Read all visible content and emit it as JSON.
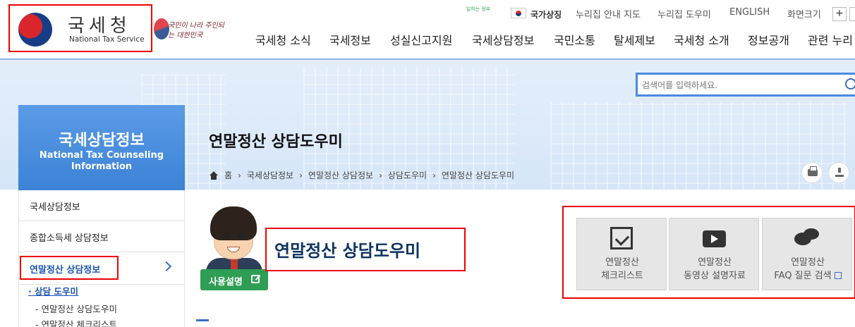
{
  "brand": {
    "name_ko": "국세청",
    "name_en": "National Tax Service",
    "slogan": "국민이 나라 주인되는 대한민국"
  },
  "util_nav": {
    "gov_badge": "일하는 정부",
    "items": [
      "국가상징",
      "누리집 안내 지도",
      "누리집 도우미",
      "ENGLISH",
      "화면크기"
    ],
    "zoom_in": "+"
  },
  "gnb": [
    "국세청 소식",
    "국세정보",
    "성실신고지원",
    "국세상담정보",
    "국민소통",
    "탈세제보",
    "국세청 소개",
    "정보공개",
    "관련 누리"
  ],
  "search": {
    "placeholder": "검색어를 입력하세요."
  },
  "section": {
    "title_ko": "국세상담정보",
    "title_en": "National Tax Counseling Information"
  },
  "page": {
    "title": "연말정산 상담도우미",
    "breadcrumb": [
      "홈",
      "국세상담정보",
      "연말정산 상담정보",
      "상담도우미",
      "연말정산 상담도우미"
    ]
  },
  "sidebar": {
    "items": [
      "국세상담정보",
      "종합소득세 상담정보",
      "연말정산 상담정보"
    ],
    "sub_items": [
      "· 상담 도우미",
      "- 연말정산 상담도우미",
      "- 연말정산 체크리스트"
    ]
  },
  "content": {
    "heading": "연말정산 상담도우미",
    "guide_button": "사용설명",
    "tiles": [
      {
        "line1": "연말정산",
        "line2": "체크리스트",
        "icon": "checklist-icon"
      },
      {
        "line1": "연말정산",
        "line2": "동영상 설명자료",
        "icon": "video-icon"
      },
      {
        "line1": "연말정산",
        "line2": "FAQ 질문 검색",
        "icon": "chat-icon"
      }
    ]
  },
  "colors": {
    "brand_blue": "#3c82d6",
    "highlight_red": "#e00000",
    "guide_green": "#2f9e55",
    "heading_navy": "#0f3460"
  }
}
